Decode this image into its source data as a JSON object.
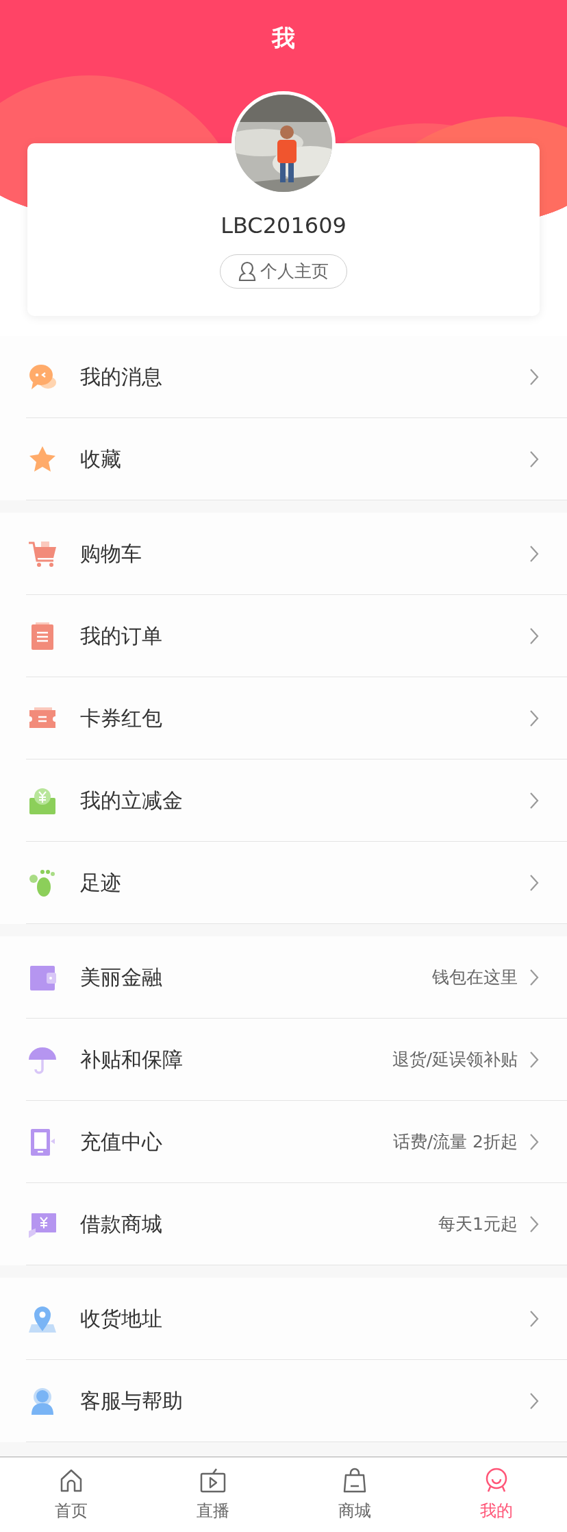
{
  "header": {
    "title": "我"
  },
  "profile": {
    "username": "LBC201609",
    "homepage_button": "个人主页"
  },
  "menu_groups": [
    {
      "items": [
        {
          "label": "我的消息"
        },
        {
          "label": "收藏"
        }
      ]
    },
    {
      "items": [
        {
          "label": "购物车"
        },
        {
          "label": "我的订单"
        },
        {
          "label": "卡券红包"
        },
        {
          "label": "我的立减金"
        },
        {
          "label": "足迹"
        }
      ]
    },
    {
      "items": [
        {
          "label": "美丽金融",
          "hint": "钱包在这里"
        },
        {
          "label": "补贴和保障",
          "hint": "退货/延误领补贴"
        },
        {
          "label": "充值中心",
          "hint": "话费/流量 2折起"
        },
        {
          "label": "借款商城",
          "hint": "每天1元起"
        }
      ]
    },
    {
      "items": [
        {
          "label": "收货地址"
        },
        {
          "label": "客服与帮助"
        }
      ]
    }
  ],
  "tab_bar": [
    {
      "label": "首页",
      "selected": false
    },
    {
      "label": "直播",
      "selected": false
    },
    {
      "label": "商城",
      "selected": false
    },
    {
      "label": "我的",
      "selected": true
    }
  ]
}
